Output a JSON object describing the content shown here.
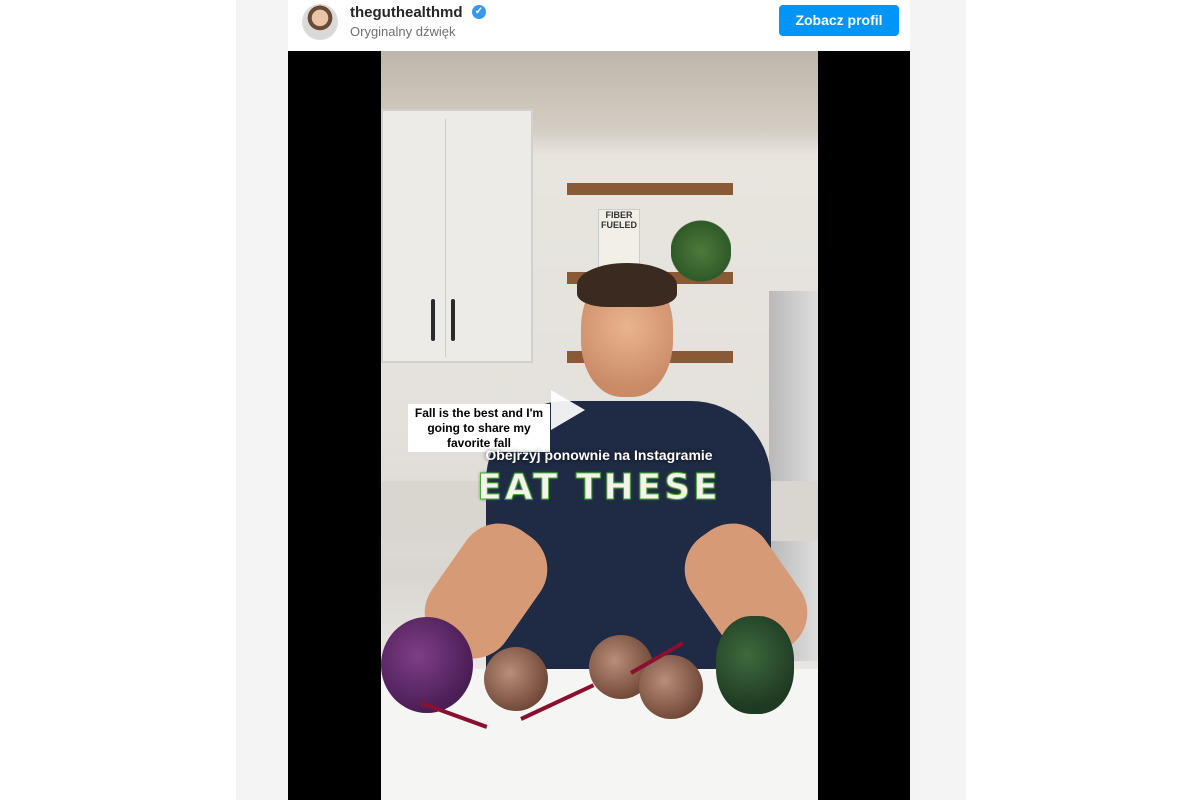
{
  "post": {
    "username": "theguthealthmd",
    "audio_label": "Oryginalny dźwięk",
    "view_profile_label": "Zobacz profil",
    "verified_badge": "✓"
  },
  "video": {
    "caption": "Fall is the best and I'm going to share my favorite fall",
    "rewatch_label": "Obejrzyj ponownie na Instagramie",
    "overlay_text": "EAT THESE",
    "book_text": "FIBER FUELED"
  },
  "colors": {
    "accent": "#0095f6",
    "overlay_outline": "#4ea53f"
  }
}
